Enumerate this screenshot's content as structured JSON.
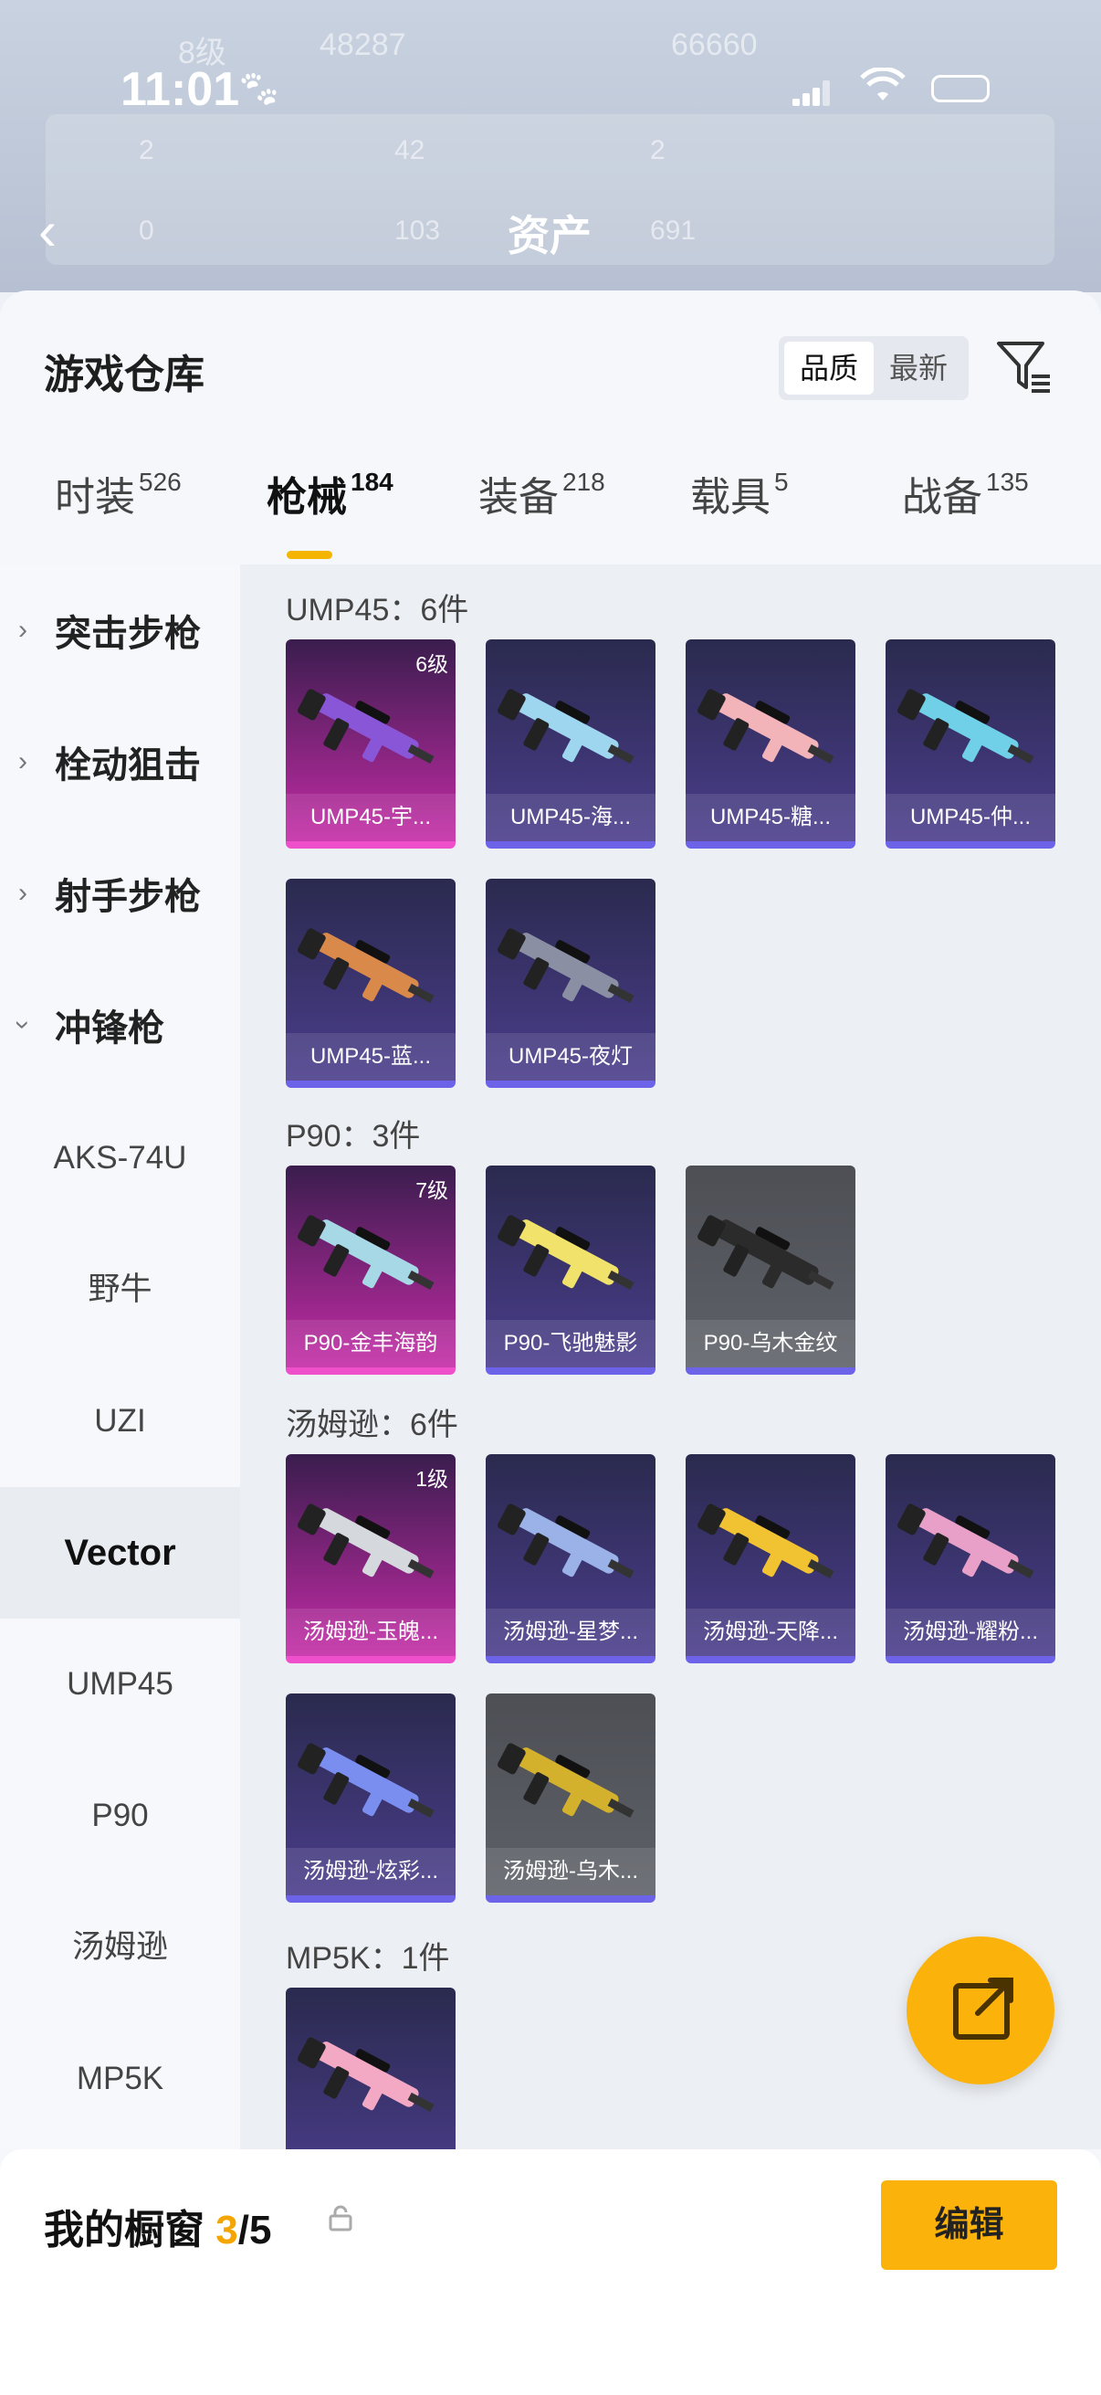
{
  "status_bar": {
    "time": "11:01"
  },
  "background": {
    "ghost_1": "8级",
    "ghost_2": "48287",
    "ghost_3": "66660",
    "ghost_4": "2",
    "ghost_5": "42",
    "ghost_6": "2",
    "ghost_7": "0",
    "ghost_8": "103",
    "ghost_9": "691"
  },
  "nav": {
    "title": "资产"
  },
  "header": {
    "title": "游戏仓库",
    "sort": {
      "quality": "品质",
      "newest": "最新"
    }
  },
  "tabs": [
    {
      "label": "时装",
      "count": "526"
    },
    {
      "label": "枪械",
      "count": "184"
    },
    {
      "label": "装备",
      "count": "218"
    },
    {
      "label": "载具",
      "count": "5"
    },
    {
      "label": "战备",
      "count": "135"
    }
  ],
  "sidebar": {
    "groups": [
      {
        "label": "突击步枪"
      },
      {
        "label": "栓动狙击"
      },
      {
        "label": "射手步枪"
      },
      {
        "label": "冲锋枪"
      }
    ],
    "subitems": [
      "AKS-74U",
      "野牛",
      "UZI",
      "Vector",
      "UMP45",
      "P90",
      "汤姆逊",
      "MP5K"
    ]
  },
  "sections": [
    {
      "title": "UMP45：6件",
      "items": [
        {
          "name": "UMP45-宇...",
          "level": "6级",
          "rarity": "pink"
        },
        {
          "name": "UMP45-海...",
          "level": "",
          "rarity": "purple"
        },
        {
          "name": "UMP45-糖...",
          "level": "",
          "rarity": "purple"
        },
        {
          "name": "UMP45-仲...",
          "level": "",
          "rarity": "purple"
        },
        {
          "name": "UMP45-蓝...",
          "level": "",
          "rarity": "purple"
        },
        {
          "name": "UMP45-夜灯",
          "level": "",
          "rarity": "purple"
        }
      ]
    },
    {
      "title": "P90：3件",
      "items": [
        {
          "name": "P90-金丰海韵",
          "level": "7级",
          "rarity": "pink"
        },
        {
          "name": "P90-飞驰魅影",
          "level": "",
          "rarity": "purple"
        },
        {
          "name": "P90-乌木金纹",
          "level": "",
          "rarity": "gray"
        }
      ]
    },
    {
      "title": "汤姆逊：6件",
      "items": [
        {
          "name": "汤姆逊-玉魄...",
          "level": "1级",
          "rarity": "pink"
        },
        {
          "name": "汤姆逊-星梦...",
          "level": "",
          "rarity": "purple"
        },
        {
          "name": "汤姆逊-天降...",
          "level": "",
          "rarity": "purple"
        },
        {
          "name": "汤姆逊-耀粉...",
          "level": "",
          "rarity": "purple"
        },
        {
          "name": "汤姆逊-炫彩...",
          "level": "",
          "rarity": "purple"
        },
        {
          "name": "汤姆逊-乌木...",
          "level": "",
          "rarity": "gray"
        }
      ]
    },
    {
      "title": "MP5K：1件",
      "items": [
        {
          "name": "",
          "level": "",
          "rarity": "purple"
        }
      ]
    }
  ],
  "showcase": {
    "label": "我的橱窗",
    "current": "3",
    "total": "/5",
    "edit_label": "编辑"
  },
  "colors": {
    "accent": "#fbb20a",
    "pink_rarity": "#f04fcb",
    "purple_rarity": "#6c63e8"
  }
}
